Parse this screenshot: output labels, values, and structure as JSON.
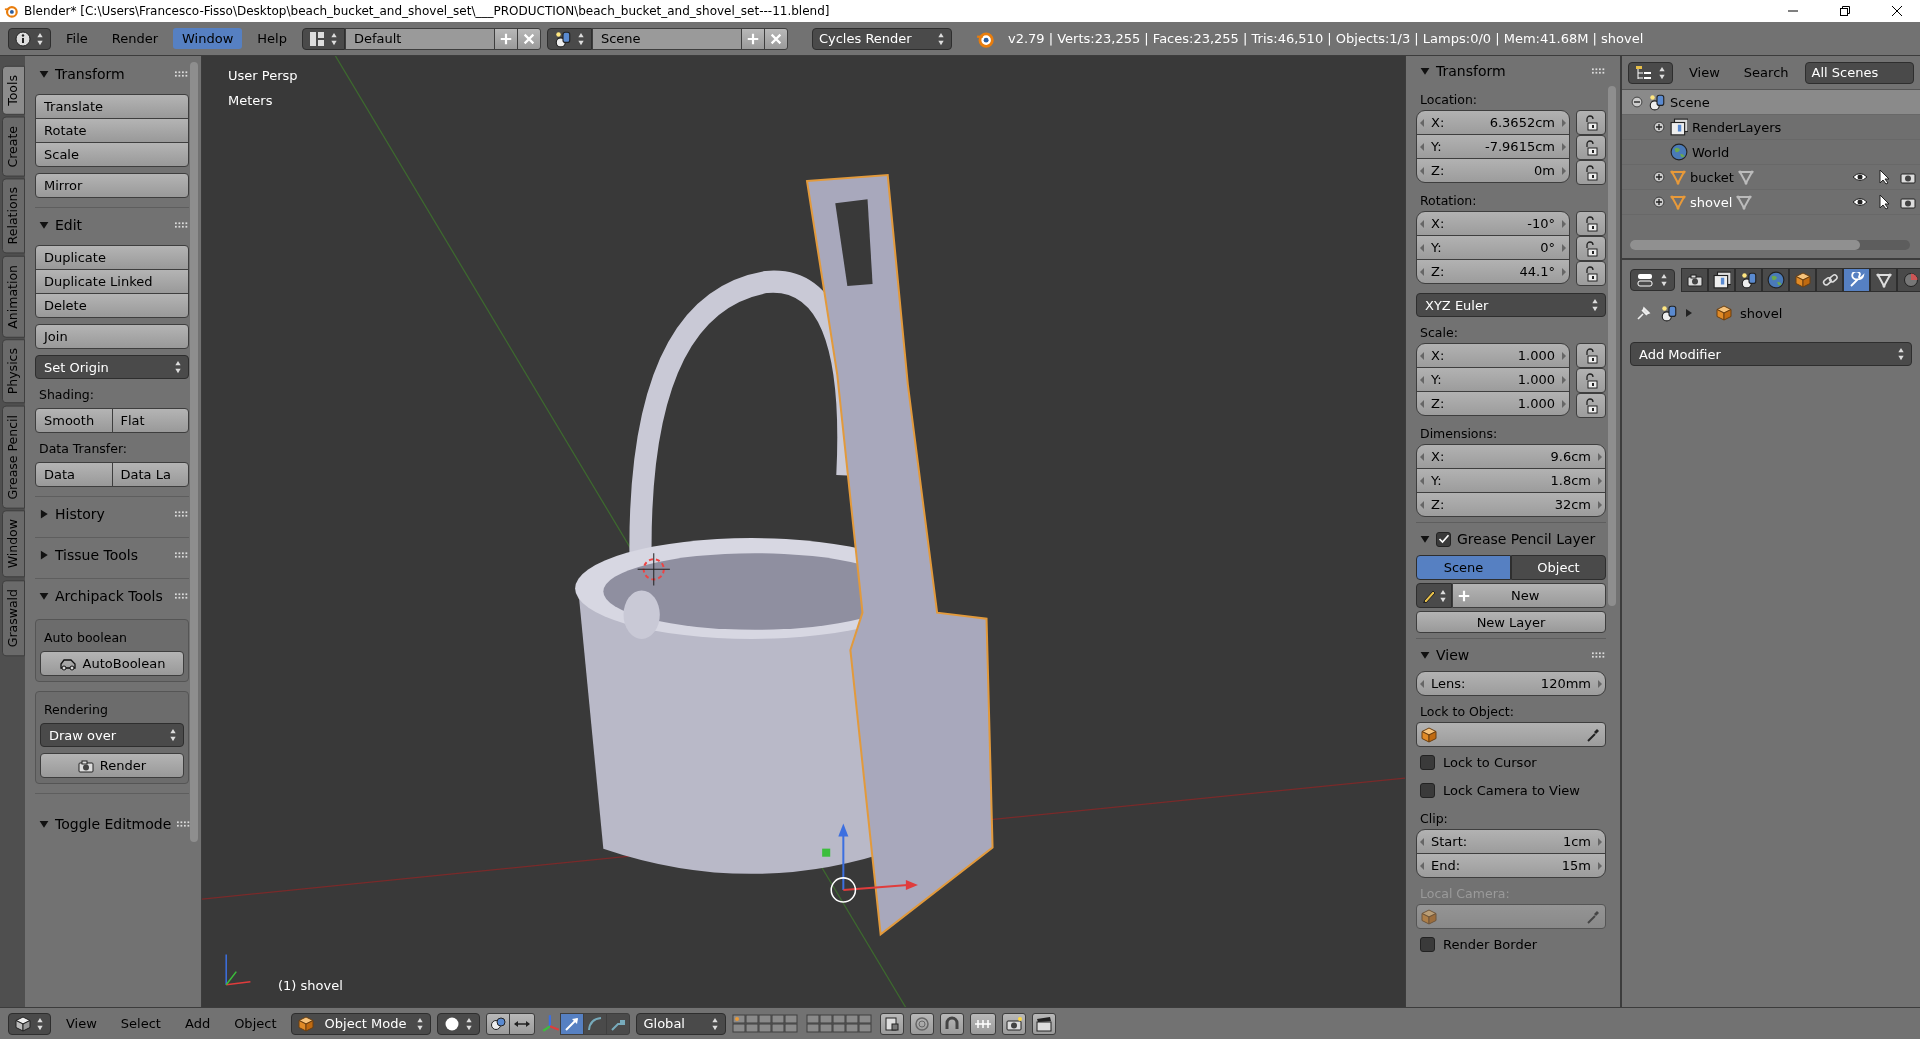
{
  "window": {
    "title": "Blender* [C:\\Users\\Francesco-Fisso\\Desktop\\beach_bucket_and_shovel_set\\___PRODUCTION\\beach_bucket_and_shovel_set---11.blend]"
  },
  "info_header": {
    "menus": [
      {
        "label": "File",
        "selected": false
      },
      {
        "label": "Render",
        "selected": false
      },
      {
        "label": "Window",
        "selected": true
      },
      {
        "label": "Help",
        "selected": false
      }
    ],
    "screen_layout": "Default",
    "scene": "Scene",
    "render_engine": "Cycles Render",
    "stats": "v2.79 | Verts:23,255 | Faces:23,255 | Tris:46,510 | Objects:1/3 | Lamps:0/0 | Mem:41.68M | shovel"
  },
  "tool_tabs": [
    {
      "label": "Tools",
      "selected": true
    },
    {
      "label": "Create",
      "selected": false
    },
    {
      "label": "Relations",
      "selected": false
    },
    {
      "label": "Animation",
      "selected": false
    },
    {
      "label": "Physics",
      "selected": false
    },
    {
      "label": "Grease Pencil",
      "selected": false
    },
    {
      "label": "Window",
      "selected": false
    },
    {
      "label": "Graswald",
      "selected": false
    }
  ],
  "tool_panel": {
    "sections": [
      {
        "title": "Transform",
        "expanded": true,
        "items": [
          {
            "kind": "stack",
            "labels": [
              "Translate",
              "Rotate",
              "Scale"
            ]
          },
          {
            "kind": "button",
            "label": "Mirror"
          }
        ]
      },
      {
        "title": "Edit",
        "expanded": true,
        "items": [
          {
            "kind": "stack",
            "labels": [
              "Duplicate",
              "Duplicate Linked",
              "Delete"
            ]
          },
          {
            "kind": "button",
            "label": "Join"
          },
          {
            "kind": "dropdown",
            "label": "Set Origin"
          },
          {
            "kind": "caption",
            "label": "Shading:"
          },
          {
            "kind": "row",
            "labels": [
              "Smooth",
              "Flat"
            ]
          },
          {
            "kind": "caption",
            "label": "Data Transfer:"
          },
          {
            "kind": "row",
            "labels": [
              "Data",
              "Data La"
            ]
          }
        ]
      },
      {
        "title": "History",
        "expanded": false
      },
      {
        "title": "Tissue Tools",
        "expanded": false
      },
      {
        "title": "Archipack Tools",
        "expanded": true,
        "items": [
          {
            "kind": "box",
            "caption": "Auto boolean",
            "button": {
              "label": "AutoBoolean"
            }
          },
          {
            "kind": "box",
            "caption": "Rendering",
            "dropdown": "Draw over",
            "button": {
              "label": "Render"
            }
          }
        ]
      }
    ],
    "footer_section": {
      "title": "Toggle Editmode",
      "expanded": true
    }
  },
  "viewport": {
    "view_name": "User Persp",
    "units": "Meters",
    "object_label": "(1) shovel"
  },
  "properties_region": {
    "transform": {
      "title": "Transform",
      "expanded": true,
      "groups": [
        {
          "caption": "Location:",
          "locks": true,
          "fields": [
            {
              "axis": "X:",
              "value": "6.3652cm"
            },
            {
              "axis": "Y:",
              "value": "-7.9615cm"
            },
            {
              "axis": "Z:",
              "value": "0m"
            }
          ]
        },
        {
          "caption": "Rotation:",
          "locks": true,
          "fields": [
            {
              "axis": "X:",
              "value": "-10°"
            },
            {
              "axis": "Y:",
              "value": "0°"
            },
            {
              "axis": "Z:",
              "value": "44.1°"
            }
          ],
          "dropdown": "XYZ Euler"
        },
        {
          "caption": "Scale:",
          "locks": true,
          "fields": [
            {
              "axis": "X:",
              "value": "1.000"
            },
            {
              "axis": "Y:",
              "value": "1.000"
            },
            {
              "axis": "Z:",
              "value": "1.000"
            }
          ]
        },
        {
          "caption": "Dimensions:",
          "locks": false,
          "fields": [
            {
              "axis": "X:",
              "value": "9.6cm"
            },
            {
              "axis": "Y:",
              "value": "1.8cm"
            },
            {
              "axis": "Z:",
              "value": "32cm"
            }
          ]
        }
      ]
    },
    "grease_pencil": {
      "title": "Grease Pencil Layer",
      "expanded": true,
      "enabled": true,
      "sources": [
        {
          "label": "Scene",
          "selected": true
        },
        {
          "label": "Object",
          "selected": false
        }
      ],
      "new_button": "New",
      "new_layer_button": "New Layer"
    },
    "view": {
      "title": "View",
      "expanded": true,
      "lens": {
        "label": "Lens:",
        "value": "120mm"
      },
      "lock_object_caption": "Lock to Object:",
      "checks": [
        {
          "label": "Lock to Cursor",
          "checked": false
        },
        {
          "label": "Lock Camera to View",
          "checked": false
        }
      ],
      "clip_caption": "Clip:",
      "clip": [
        {
          "label": "Start:",
          "value": "1cm"
        },
        {
          "label": "End:",
          "value": "15m"
        }
      ],
      "local_camera": {
        "label": "Local Camera:",
        "disabled": true
      },
      "render_border": {
        "label": "Render Border",
        "checked": false
      }
    }
  },
  "outliner": {
    "menus": [
      "View",
      "Search"
    ],
    "filter": "All Scenes",
    "tree": [
      {
        "label": "Scene",
        "kind": "scene",
        "expanded": true,
        "selected": true,
        "active": false,
        "children": [
          {
            "label": "RenderLayers",
            "kind": "renderlayers",
            "expanded": false,
            "selected": false,
            "active": false
          },
          {
            "label": "World",
            "kind": "world",
            "selected": false,
            "active": false
          },
          {
            "label": "bucket",
            "kind": "mesh",
            "expanded": false,
            "selected": false,
            "active": false,
            "visible": true,
            "selectable": true,
            "renderable": true
          },
          {
            "label": "shovel",
            "kind": "mesh",
            "expanded": false,
            "selected": false,
            "active": true,
            "visible": true,
            "selectable": true,
            "renderable": true
          }
        ]
      }
    ]
  },
  "properties_editor": {
    "tabs": [
      {
        "kind": "render",
        "selected": false
      },
      {
        "kind": "layers",
        "selected": false
      },
      {
        "kind": "scene",
        "selected": false
      },
      {
        "kind": "world",
        "selected": false
      },
      {
        "kind": "object",
        "selected": false
      },
      {
        "kind": "constraints",
        "selected": false
      },
      {
        "kind": "modifiers",
        "selected": true
      },
      {
        "kind": "data",
        "selected": false
      },
      {
        "kind": "material",
        "selected": false
      }
    ],
    "object": "shovel",
    "add_modifier": "Add Modifier"
  },
  "view3d_header": {
    "menus": [
      "View",
      "Select",
      "Add",
      "Object"
    ],
    "mode": "Object Mode",
    "orientation": "Global",
    "manipulators": [
      {
        "kind": "translate",
        "selected": true
      },
      {
        "kind": "rotate",
        "selected": false
      },
      {
        "kind": "scale",
        "selected": false
      }
    ]
  }
}
